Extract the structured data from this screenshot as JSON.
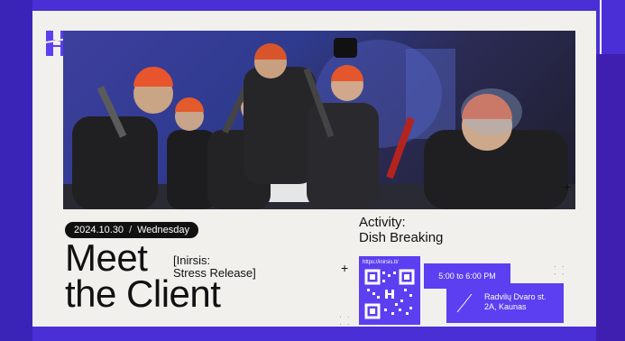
{
  "event": {
    "date": "2024.10.30",
    "weekday": "Wednesday",
    "title_line1": "Meet",
    "title_line2": "the Client",
    "sub_line1": "[Inirsis:",
    "sub_line2": "Stress Release]",
    "activity_line1": "Activity:",
    "activity_line2": "Dish Breaking",
    "qr_url": "https://inirsis.lt/",
    "time": "5:00 to 6:00 PM",
    "address_line1": "Radvilų Dvaro st.",
    "address_line2": "2A, Kaunas"
  },
  "icons": {
    "logo": "h-logo-icon",
    "plus": "plus-icon",
    "dots": "dot-grid-icon"
  },
  "colors": {
    "brand_purple": "#5b3ff0",
    "background": "#4a2fd6",
    "card": "#f1f0ec",
    "text": "#111111"
  }
}
